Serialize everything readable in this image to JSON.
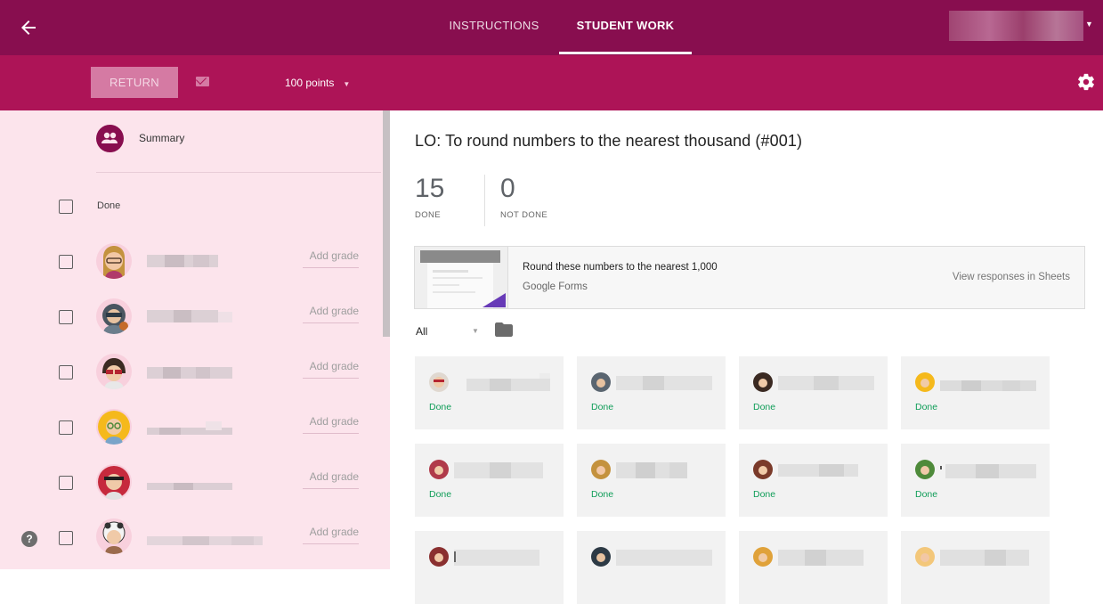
{
  "topbar": {
    "tabs": [
      {
        "label": "INSTRUCTIONS"
      },
      {
        "label": "STUDENT WORK"
      }
    ]
  },
  "actionbar": {
    "return_label": "RETURN",
    "points_label": "100 points"
  },
  "sidebar": {
    "summary_label": "Summary",
    "done_label": "Done",
    "students": [
      {
        "add_grade": "Add grade"
      },
      {
        "add_grade": "Add grade"
      },
      {
        "add_grade": "Add grade"
      },
      {
        "add_grade": "Add grade"
      },
      {
        "add_grade": "Add grade"
      },
      {
        "add_grade": "Add grade"
      }
    ]
  },
  "main": {
    "title": "LO: To round numbers to the nearest thousand (#001)",
    "done_count": "15",
    "done_caption": "DONE",
    "not_done_count": "0",
    "not_done_caption": "NOT DONE",
    "attachment": {
      "title": "Round these numbers to the nearest 1,000",
      "subtitle": "Google Forms",
      "action": "View responses in Sheets"
    },
    "filter": "All",
    "cards": [
      {
        "status": "Done"
      },
      {
        "status": "Done"
      },
      {
        "status": "Done"
      },
      {
        "status": "Done"
      },
      {
        "status": "Done"
      },
      {
        "status": "Done"
      },
      {
        "status": "Done"
      },
      {
        "status": "Done"
      },
      {
        "status": ""
      },
      {
        "status": ""
      },
      {
        "status": ""
      },
      {
        "status": ""
      }
    ]
  },
  "colors": {
    "topbar": "#880e4f",
    "actionbar": "#ad1457",
    "sidebar": "#fce4ec",
    "done_status": "#0f9d58"
  },
  "help_glyph": "?"
}
